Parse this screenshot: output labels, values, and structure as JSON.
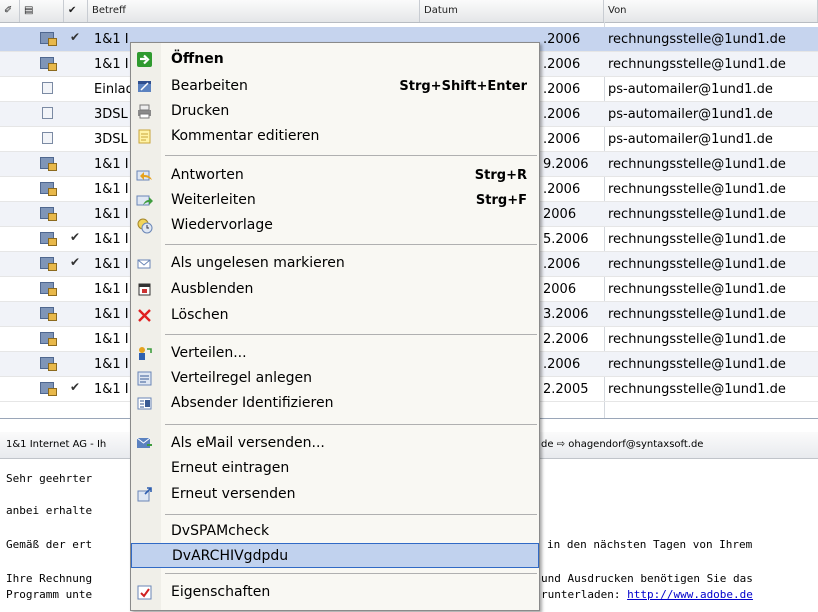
{
  "list": {
    "headers": {
      "subject": "Betreff",
      "date": "Datum",
      "from": "Von"
    },
    "rows": [
      {
        "subject": "1&1 I",
        "date": ".2006",
        "from": "rechnungsstelle@1und1.de",
        "icon": "mail-icon",
        "checked": "✔"
      },
      {
        "subject": "1&1 I",
        "date": ".2006",
        "from": "rechnungsstelle@1und1.de",
        "icon": "mail-icon",
        "checked": ""
      },
      {
        "subject": "Einlad",
        "date": ".2006",
        "from": "ps-automailer@1und1.de",
        "icon": "doc-icon",
        "checked": ""
      },
      {
        "subject": "3DSL",
        "date": ".2006",
        "from": "ps-automailer@1und1.de",
        "icon": "doc-icon",
        "checked": ""
      },
      {
        "subject": "3DSL",
        "date": ".2006",
        "from": "ps-automailer@1und1.de",
        "icon": "doc-icon",
        "checked": ""
      },
      {
        "subject": "1&1 I",
        "date": "9.2006",
        "from": "rechnungsstelle@1und1.de",
        "icon": "mail-icon",
        "checked": ""
      },
      {
        "subject": "1&1 I",
        "date": ".2006",
        "from": "rechnungsstelle@1und1.de",
        "icon": "mail-icon",
        "checked": ""
      },
      {
        "subject": "1&1 I",
        "date": "2006",
        "from": "rechnungsstelle@1und1.de",
        "icon": "mail-icon",
        "checked": ""
      },
      {
        "subject": "1&1 I",
        "date": "5.2006",
        "from": "rechnungsstelle@1und1.de",
        "icon": "mail-icon",
        "checked": "✔"
      },
      {
        "subject": "1&1 I",
        "date": ".2006",
        "from": "rechnungsstelle@1und1.de",
        "icon": "mail-icon",
        "checked": "✔"
      },
      {
        "subject": "1&1 I",
        "date": "2006",
        "from": "rechnungsstelle@1und1.de",
        "icon": "mail-icon",
        "checked": ""
      },
      {
        "subject": "1&1 I",
        "date": "3.2006",
        "from": "rechnungsstelle@1und1.de",
        "icon": "mail-icon",
        "checked": ""
      },
      {
        "subject": "1&1 I",
        "date": "2.2006",
        "from": "rechnungsstelle@1und1.de",
        "icon": "mail-icon",
        "checked": ""
      },
      {
        "subject": "1&1 I",
        "date": ".2006",
        "from": "rechnungsstelle@1und1.de",
        "icon": "mail-icon",
        "checked": ""
      },
      {
        "subject": "1&1 I",
        "date": "2.2005",
        "from": "rechnungsstelle@1und1.de",
        "icon": "mail-icon",
        "checked": "✔"
      }
    ]
  },
  "preview": {
    "header_left": "1&1 Internet AG - Ih",
    "header_right": "de ⇨ ohagendorf@syntaxsoft.de",
    "lines": [
      "Sehr geehrter",
      "anbei erhalte",
      "Gemäß der ert",
      "Ihre Rechnung",
      "Programm unte"
    ],
    "right_lines": [
      "in den nächsten Tagen von Ihrem",
      "und Ausdrucken benötigen Sie das",
      "runterladen: "
    ],
    "link": "http://www.adobe.de"
  },
  "menu": {
    "items": [
      {
        "label": "Öffnen",
        "shortcut": ""
      },
      {
        "label": "Bearbeiten",
        "shortcut": "Strg+Shift+Enter"
      },
      {
        "label": "Drucken",
        "shortcut": ""
      },
      {
        "label": "Kommentar editieren",
        "shortcut": ""
      },
      {
        "label": "Antworten",
        "shortcut": "Strg+R"
      },
      {
        "label": "Weiterleiten",
        "shortcut": "Strg+F"
      },
      {
        "label": "Wiedervorlage",
        "shortcut": ""
      },
      {
        "label": "Als ungelesen markieren",
        "shortcut": ""
      },
      {
        "label": "Ausblenden",
        "shortcut": ""
      },
      {
        "label": "Löschen",
        "shortcut": ""
      },
      {
        "label": "Verteilen...",
        "shortcut": ""
      },
      {
        "label": "Verteilregel anlegen",
        "shortcut": ""
      },
      {
        "label": "Absender Identifizieren",
        "shortcut": ""
      },
      {
        "label": "Als eMail versenden...",
        "shortcut": ""
      },
      {
        "label": "Erneut eintragen",
        "shortcut": ""
      },
      {
        "label": "Erneut versenden",
        "shortcut": ""
      },
      {
        "label": "DvSPAMcheck",
        "shortcut": ""
      },
      {
        "label": "DvARCHIVgdpdu",
        "shortcut": ""
      },
      {
        "label": "Eigenschaften",
        "shortcut": ""
      }
    ]
  },
  "colors": {
    "selection": "#c6d4ee",
    "menu_highlight": "#c1d2ee",
    "menu_border": "#316ac5",
    "delete_red": "#e02020"
  }
}
